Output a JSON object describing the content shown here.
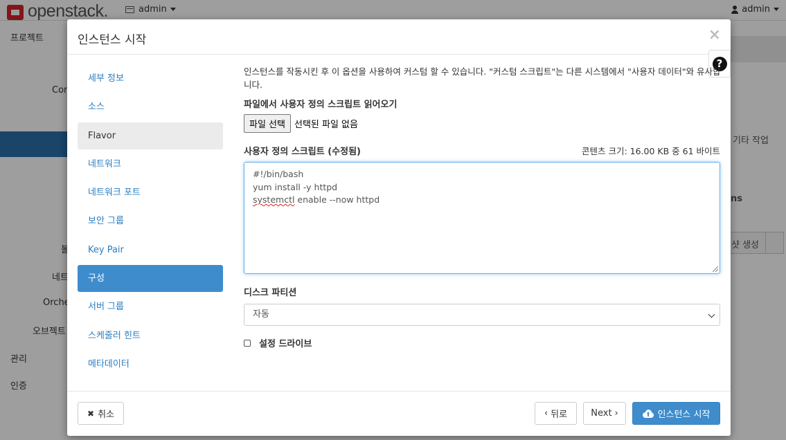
{
  "background": {
    "brand": "openstack.",
    "project_switcher": "admin",
    "user_menu": "admin",
    "sidebar_items": [
      "프로젝트",
      "Com",
      "볼",
      "네트",
      "Orche",
      "오브젝트",
      "관리",
      "인증"
    ],
    "right_texts": [
      "기타 작업",
      "ns",
      "샷 생성"
    ]
  },
  "modal": {
    "title": "인스턴스 시작",
    "close_symbol": "×",
    "help_symbol": "?",
    "nav": [
      {
        "label": "세부 정보"
      },
      {
        "label": "소스"
      },
      {
        "label": "Flavor"
      },
      {
        "label": "네트워크"
      },
      {
        "label": "네트워크 포트"
      },
      {
        "label": "보안 그룹"
      },
      {
        "label": "Key Pair"
      },
      {
        "label": "구성"
      },
      {
        "label": "서버 그룹"
      },
      {
        "label": "스케줄러 힌트"
      },
      {
        "label": "메타데이터"
      }
    ],
    "active_nav": "구성",
    "config": {
      "description": "인스턴스를 작동시킨 후 이 옵션을 사용하여 커스텀 할 수 있습니다. \"커스텀 스크립트\"는 다른 시스템에서 \"사용자 데이터\"와 유사합니다.",
      "file_load_label": "파일에서 사용자 정의 스크립트 읽어오기",
      "file_button": "파일 선택",
      "file_status": "선택된 파일 없음",
      "script_label": "사용자 정의 스크립트 (수정됨)",
      "content_size": "콘텐츠 크기: 16.00 KB 중 61 바이트",
      "script_lines": [
        "#!/bin/bash",
        "yum install -y httpd"
      ],
      "script_line3_word": "systemctl",
      "script_line3_rest": " enable --now httpd",
      "disk_partition_label": "디스크 파티션",
      "disk_partition_value": "자동",
      "config_drive_label": "설정 드라이브",
      "config_drive_checked": false
    },
    "footer": {
      "cancel": "취소",
      "back": "뒤로",
      "next": "Next",
      "launch": "인스턴스 시작"
    }
  },
  "colors": {
    "primary": "#3f8ccc",
    "link": "#2a7ec0",
    "brand_red": "#d2232a"
  }
}
